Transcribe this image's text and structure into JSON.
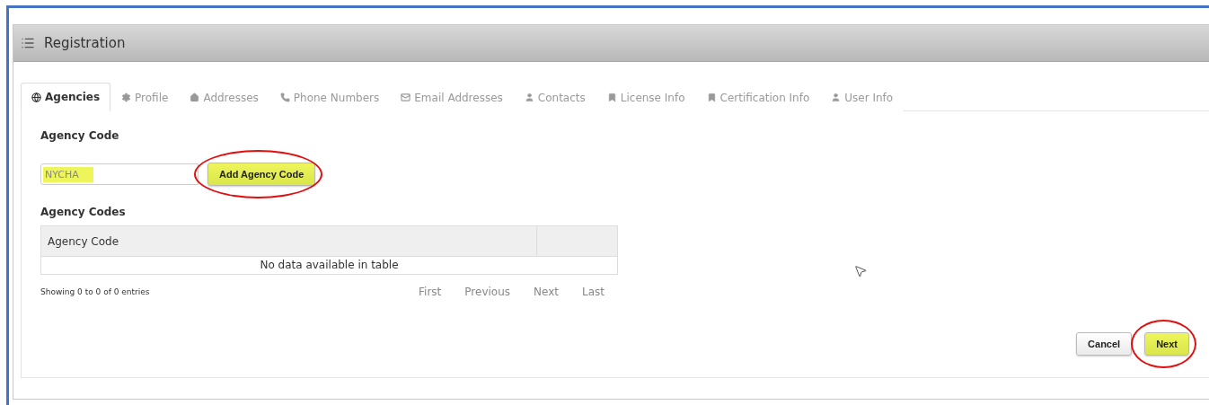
{
  "panel": {
    "title": "Registration"
  },
  "tabs": [
    {
      "label": "Agencies",
      "selected": true
    },
    {
      "label": "Profile",
      "selected": false
    },
    {
      "label": "Addresses",
      "selected": false
    },
    {
      "label": "Phone Numbers",
      "selected": false
    },
    {
      "label": "Email Addresses",
      "selected": false
    },
    {
      "label": "Contacts",
      "selected": false
    },
    {
      "label": "License Info",
      "selected": false
    },
    {
      "label": "Certification Info",
      "selected": false
    },
    {
      "label": "User Info",
      "selected": false
    }
  ],
  "agency_code_field": {
    "label": "Agency Code",
    "value": "NYCHA",
    "highlighted": true
  },
  "add_button": {
    "label": "Add Agency Code",
    "highlighted": true,
    "circled": true
  },
  "table": {
    "title": "Agency Codes",
    "columns": [
      "Agency Code"
    ],
    "empty_message": "No data available in table"
  },
  "info": "Showing 0 to 0 of 0 entries",
  "pagination": [
    "First",
    "Previous",
    "Next",
    "Last"
  ],
  "footer_buttons": [
    {
      "label": "Cancel",
      "highlighted": false,
      "circled": false
    },
    {
      "label": "Next",
      "highlighted": true,
      "circled": true
    }
  ]
}
